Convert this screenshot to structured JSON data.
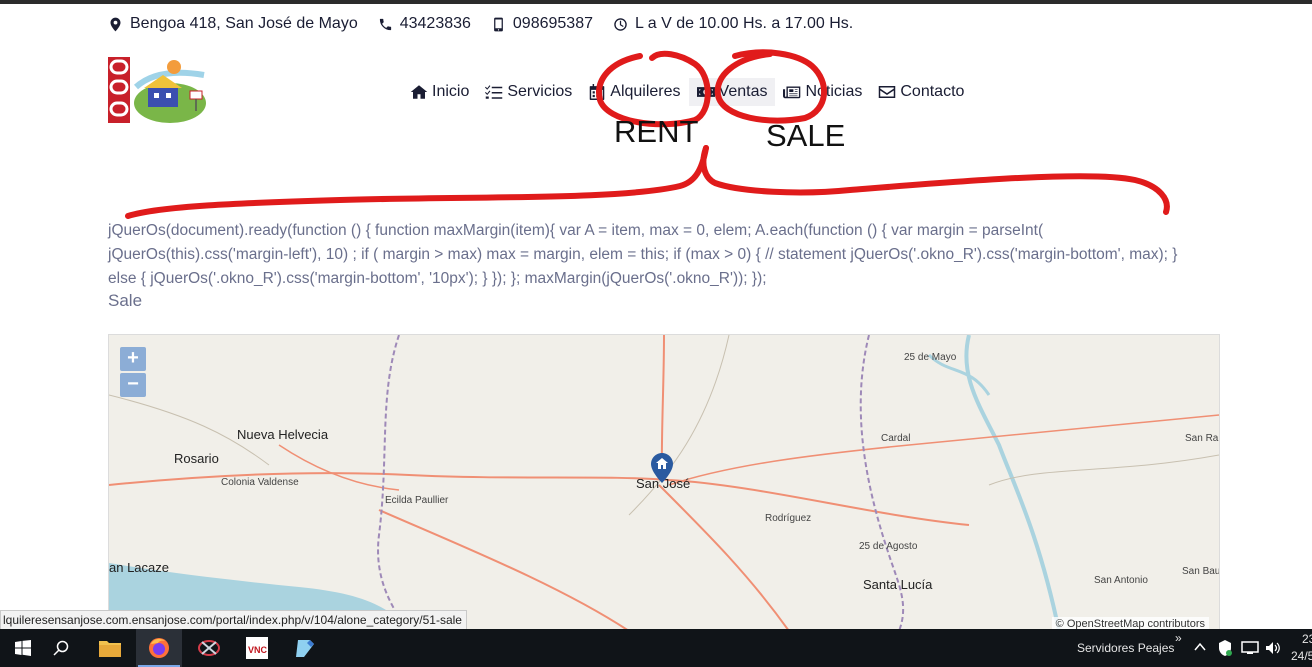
{
  "contact": {
    "address": "Bengoa 418, San José de Mayo",
    "phone": "43423836",
    "mobile": "098695387",
    "hours": "L a V de 10.00 Hs. a 17.00 Hs."
  },
  "nav": {
    "items": [
      {
        "label": "Inicio",
        "icon": "home-icon"
      },
      {
        "label": "Servicios",
        "icon": "list-check-icon"
      },
      {
        "label": "Alquileres",
        "icon": "calendar-icon"
      },
      {
        "label": "Ventas",
        "icon": "money-bill-icon"
      },
      {
        "label": "Noticias",
        "icon": "newspaper-icon"
      },
      {
        "label": "Contacto",
        "icon": "envelope-icon"
      }
    ],
    "active_index": 3
  },
  "annotations": {
    "rent": "RENT",
    "sale": "SALE",
    "stroke_color": "#e01b1b"
  },
  "content": {
    "code_text": "jQuerOs(document).ready(function () { function maxMargin(item){ var A = item, max = 0, elem; A.each(function () { var margin = parseInt( jQuerOs(this).css('margin-left'), 10) ; if ( margin > max) max = margin, elem = this; if (max > 0) { // statement jQuerOs('.okno_R').css('margin-bottom', max); } else { jQuerOs('.okno_R').css('margin-bottom', '10px'); } }); }; maxMargin(jQuerOs('.okno_R')); });",
    "category_label": "Sale"
  },
  "map": {
    "zoom_in": "+",
    "zoom_out": "−",
    "places": {
      "nueva_helvecia": "Nueva Helvecia",
      "rosario": "Rosario",
      "colonia_valdense": "Colonia Valdense",
      "ecilda_paullier": "Ecilda Paullier",
      "san_jose": "San José",
      "rodriguez": "Rodríguez",
      "veinticinco_agosto": "25 de Agosto",
      "santa_lucia": "Santa Lucía",
      "cardal": "Cardal",
      "veinticinco_mayo": "25 de Mayo",
      "san_ra": "San Ra",
      "san_antonio": "San Antonio",
      "san_bau": "San Bau",
      "lacaze": "an Lacaze"
    },
    "attribution": "© OpenStreetMap contributors",
    "colors": {
      "land": "#f1efe9",
      "water": "#aad3df",
      "road": "#f08f74",
      "border": "#9e89b8"
    }
  },
  "status_url": "lquileresensanjose.com.ensanjose.com/portal/index.php/v/104/alone_category/51-sale",
  "taskbar": {
    "tray_label": "Servidores Peajes",
    "chevron": "»",
    "time_partial": "23",
    "date_partial": "24/5"
  }
}
